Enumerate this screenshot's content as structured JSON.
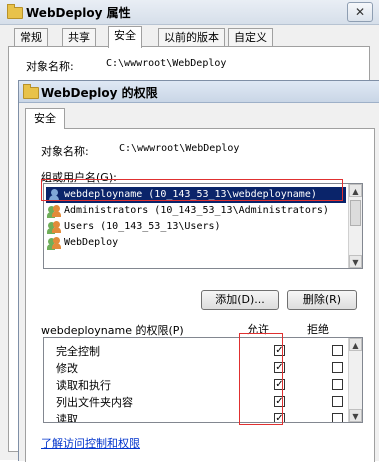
{
  "outer_dialog": {
    "title": "WebDeploy 属性",
    "close_glyph": "✕",
    "tabs": [
      "常规",
      "共享",
      "安全",
      "以前的版本",
      "自定义"
    ],
    "active_tab": "安全",
    "object_name_label": "对象名称:",
    "object_name_value": "C:\\wwwroot\\WebDeploy"
  },
  "inner_dialog": {
    "title": "WebDeploy 的权限",
    "tab": "安全",
    "object_name_label": "对象名称:",
    "object_name_value": "C:\\wwwroot\\WebDeploy",
    "group_label": "组或用户名(G):",
    "users": [
      {
        "name": "webdeployname (10_143_53_13\\webdeployname)",
        "selected": true
      },
      {
        "name": "Administrators (10_143_53_13\\Administrators)",
        "selected": false
      },
      {
        "name": "Users (10_143_53_13\\Users)",
        "selected": false
      },
      {
        "name": "WebDeploy",
        "selected": false
      }
    ],
    "add_button": "添加(D)...",
    "remove_button": "删除(R)",
    "permissions_for": "webdeployname 的权限(P)",
    "allow_header": "允许",
    "deny_header": "拒绝",
    "permissions": [
      {
        "label": "完全控制",
        "allow": true,
        "deny": false
      },
      {
        "label": "修改",
        "allow": true,
        "deny": false
      },
      {
        "label": "读取和执行",
        "allow": true,
        "deny": false
      },
      {
        "label": "列出文件夹内容",
        "allow": true,
        "deny": false
      },
      {
        "label": "读取",
        "allow": true,
        "deny": false
      }
    ],
    "help_link": "了解访问控制和权限"
  },
  "colors": {
    "selection": "#0a246a",
    "highlight_box": "#e03030",
    "link": "#0033cc"
  }
}
